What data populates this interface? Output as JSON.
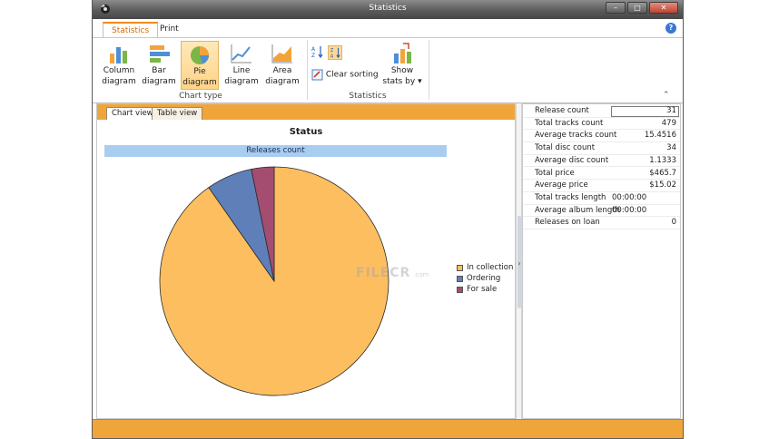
{
  "window": {
    "title": "Statistics",
    "controls": {
      "minimize": "–",
      "maximize": "□",
      "close": "✕"
    }
  },
  "ribbon": {
    "tabs": [
      {
        "label": "Statistics",
        "active": true
      },
      {
        "label": "Print",
        "active": false
      }
    ],
    "chart_type_group": {
      "label": "Chart type",
      "buttons": [
        {
          "label_line1": "Column",
          "label_line2": "diagram",
          "icon": "column-chart-icon",
          "selected": false
        },
        {
          "label_line1": "Bar",
          "label_line2": "diagram",
          "icon": "bar-chart-icon",
          "selected": false
        },
        {
          "label_line1": "Pie",
          "label_line2": "diagram",
          "icon": "pie-chart-icon",
          "selected": true
        },
        {
          "label_line1": "Line",
          "label_line2": "diagram",
          "icon": "line-chart-icon",
          "selected": false
        },
        {
          "label_line1": "Area",
          "label_line2": "diagram",
          "icon": "area-chart-icon",
          "selected": false
        }
      ]
    },
    "statistics_group": {
      "label": "Statistics",
      "clear_sorting": "Clear sorting",
      "show_stats_line1": "Show",
      "show_stats_line2": "stats by ▾"
    },
    "collapse": "⌃"
  },
  "left_pane": {
    "tabs": [
      {
        "label": "Chart view",
        "active": true
      },
      {
        "label": "Table view",
        "active": false
      }
    ]
  },
  "chart_data": {
    "type": "pie",
    "title": "Status",
    "series_name": "Releases count",
    "categories": [
      "In collection",
      "Ordering",
      "For sale"
    ],
    "values": [
      90.3,
      6.5,
      3.2
    ],
    "colors": [
      "#fdbe60",
      "#5f7fb8",
      "#a44d70"
    ],
    "legend_position": "right"
  },
  "watermark": {
    "text": "FILECR",
    "sub": ".com"
  },
  "stats": [
    {
      "label": "Release count",
      "value": "31"
    },
    {
      "label": "Total tracks count",
      "value": "479"
    },
    {
      "label": "Average tracks count",
      "value": "15.4516"
    },
    {
      "label": "Total disc count",
      "value": "34"
    },
    {
      "label": "Average disc count",
      "value": "1.1333"
    },
    {
      "label": "Total price",
      "value": "$465.7"
    },
    {
      "label": "Average price",
      "value": "$15.02"
    },
    {
      "label": "Total tracks length",
      "value": "00:00:00"
    },
    {
      "label": "Average album length",
      "value": "00:00:00"
    },
    {
      "label": "Releases on loan",
      "value": "0"
    }
  ],
  "colors": {
    "accent_orange": "#f0a53a",
    "selected_tab_text": "#d66a00"
  }
}
